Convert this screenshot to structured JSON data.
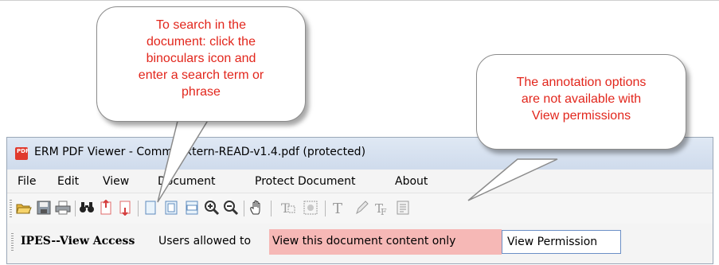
{
  "window": {
    "title": "ERM PDF Viewer - Comm_Extern-READ-v1.4.pdf (protected)",
    "icon": "pdf-app-icon"
  },
  "menu": {
    "items": [
      "File",
      "Edit",
      "View",
      "Document",
      "Protect Document",
      "About"
    ]
  },
  "toolbar": {
    "icons": [
      "open-folder-icon",
      "save-icon",
      "print-icon",
      "binoculars-search-icon",
      "previous-page-icon",
      "next-page-icon",
      "single-page-icon",
      "fit-page-icon",
      "fit-width-icon",
      "zoom-in-icon",
      "zoom-out-icon",
      "hand-pan-icon",
      "text-select-icon",
      "snapshot-icon",
      "text-annotation-icon",
      "pencil-icon",
      "stamp-text-icon",
      "notes-icon"
    ]
  },
  "access_bar": {
    "title": "IPES--View Access",
    "description": "Users allowed to",
    "highlight": "View this document content only",
    "permission": "View Permission"
  },
  "callouts": {
    "search": {
      "lines": [
        "To search in the",
        "document: click the",
        "binoculars icon and",
        "enter a search term or",
        "phrase"
      ]
    },
    "annotation": {
      "lines": [
        "The annotation options",
        "are not available with",
        "View permissions"
      ]
    }
  },
  "colors": {
    "callout_text": "#e2261c",
    "highlight": "#f6b8b6",
    "permission_border": "#6b8fc6"
  }
}
